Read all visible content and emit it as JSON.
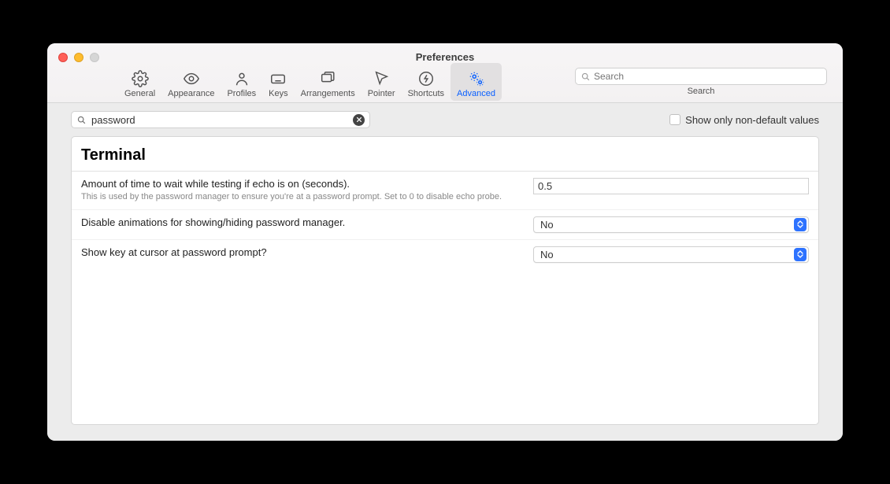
{
  "window": {
    "title": "Preferences"
  },
  "toolbar": {
    "tabs": [
      {
        "id": "general",
        "label": "General"
      },
      {
        "id": "appearance",
        "label": "Appearance"
      },
      {
        "id": "profiles",
        "label": "Profiles"
      },
      {
        "id": "keys",
        "label": "Keys"
      },
      {
        "id": "arrangements",
        "label": "Arrangements"
      },
      {
        "id": "pointer",
        "label": "Pointer"
      },
      {
        "id": "shortcuts",
        "label": "Shortcuts"
      },
      {
        "id": "advanced",
        "label": "Advanced"
      }
    ],
    "active_tab": "advanced",
    "search": {
      "placeholder": "Search",
      "label": "Search"
    }
  },
  "filter": {
    "value": "password",
    "show_non_default_label": "Show only non-default values",
    "show_non_default_checked": false
  },
  "section": {
    "title": "Terminal"
  },
  "settings": [
    {
      "title": "Amount of time to wait while testing if echo is on (seconds).",
      "description": "This is used by the password manager to ensure you're at a password prompt. Set to 0 to disable echo probe.",
      "control": "text",
      "value": "0.5"
    },
    {
      "title": "Disable animations for showing/hiding password manager.",
      "control": "select",
      "value": "No"
    },
    {
      "title": "Show key at cursor at password prompt?",
      "control": "select",
      "value": "No"
    }
  ]
}
